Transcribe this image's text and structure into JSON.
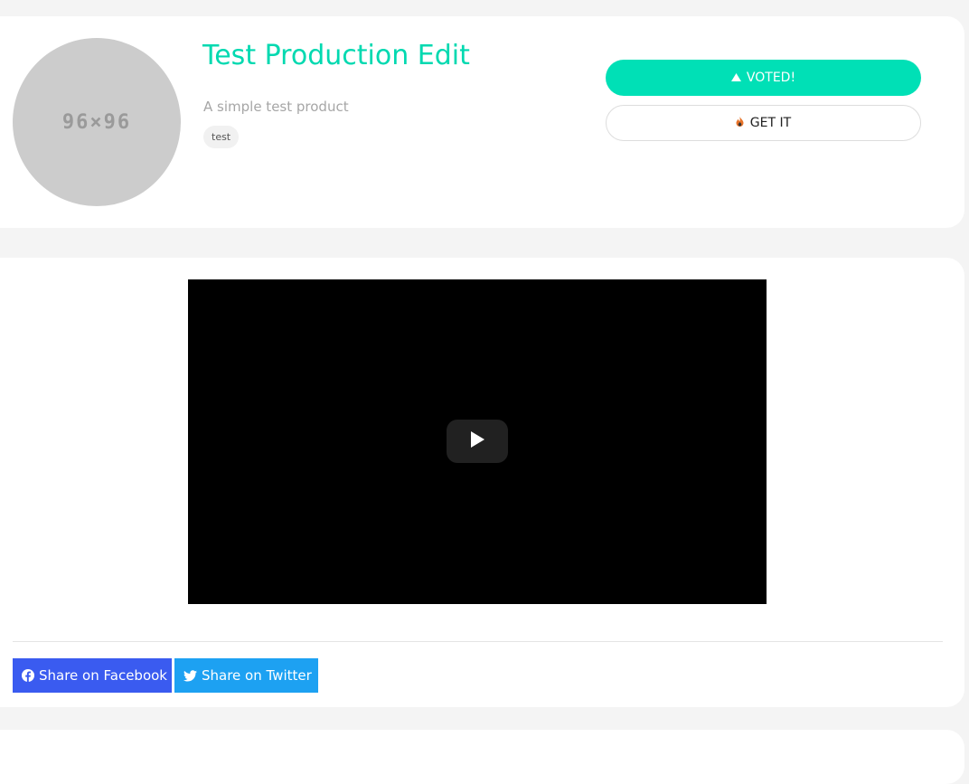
{
  "product": {
    "thumbnail_text": "96×96",
    "title": "Test Production Edit",
    "description": "A simple test product",
    "tag": "test"
  },
  "actions": {
    "voted_label": "VOTED!",
    "get_it_label": "GET IT"
  },
  "share": {
    "facebook_label": "Share on Facebook",
    "twitter_label": "Share on Twitter"
  },
  "colors": {
    "accent": "#00e0b6",
    "facebook": "#3a5bf0",
    "twitter": "#1da1f2"
  },
  "icons": {
    "voted": "caret-up-icon",
    "get_it": "fire-icon",
    "video": "play-icon",
    "facebook": "facebook-icon",
    "twitter": "twitter-icon"
  }
}
